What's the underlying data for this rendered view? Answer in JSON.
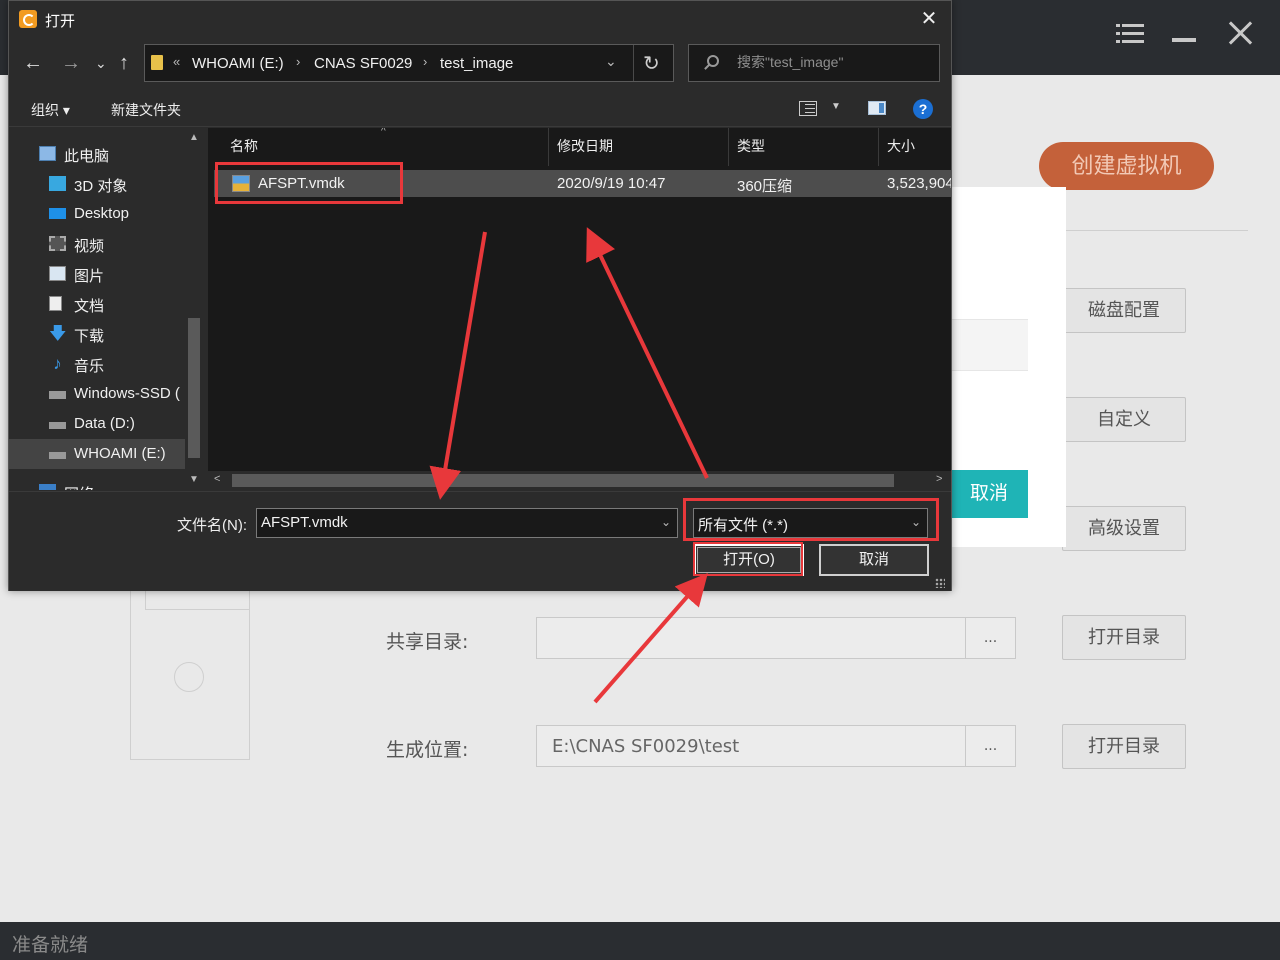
{
  "background_app": {
    "create_vm_label": "创建虚拟机",
    "side_buttons": [
      "磁盘配置",
      "自定义",
      "高级设置"
    ],
    "share_dir_label": "共享目录:",
    "share_dir_value": "",
    "output_label": "生成位置:",
    "output_value": "E:\\CNAS SF0029\\test",
    "browse_label": "...",
    "open_dir_label": "打开目录",
    "status_text": "准备就绪"
  },
  "underlying_dialog": {
    "cancel_label": "取消"
  },
  "dialog": {
    "title": "打开",
    "close_glyph": "✕",
    "nav": {
      "back": "←",
      "forward": "→",
      "recent": "⌄",
      "up": "↑"
    },
    "address": {
      "overflow": "«",
      "crumbs": [
        "WHOAMI (E:)",
        "CNAS SF0029",
        "test_image"
      ]
    },
    "search_placeholder": "搜索\"test_image\"",
    "toolbar": {
      "organize": "组织 ▾",
      "new_folder": "新建文件夹",
      "help": "?"
    },
    "nav_items": [
      {
        "label": "此电脑",
        "icon": "computer-icon"
      },
      {
        "label": "3D 对象",
        "icon": "cube-icon"
      },
      {
        "label": "Desktop",
        "icon": "desktop-icon"
      },
      {
        "label": "视频",
        "icon": "video-icon"
      },
      {
        "label": "图片",
        "icon": "picture-icon"
      },
      {
        "label": "文档",
        "icon": "document-icon"
      },
      {
        "label": "下载",
        "icon": "download-icon"
      },
      {
        "label": "音乐",
        "icon": "music-icon"
      },
      {
        "label": "Windows-SSD (",
        "icon": "drive-icon"
      },
      {
        "label": "Data (D:)",
        "icon": "drive-icon"
      },
      {
        "label": "WHOAMI (E:)",
        "icon": "drive-icon"
      },
      {
        "label": "网络",
        "icon": "network-icon"
      }
    ],
    "columns": [
      "名称",
      "修改日期",
      "类型",
      "大小"
    ],
    "files": [
      {
        "name": "AFSPT.vmdk",
        "modified": "2020/9/19 10:47",
        "type": "360压缩",
        "size": "3,523,904"
      }
    ],
    "filename_label": "文件名(N):",
    "filename_value": "AFSPT.vmdk",
    "filter_value": "所有文件 (*.*)",
    "open_button": "打开(O)",
    "cancel_button": "取消"
  },
  "colors": {
    "highlight_red": "#e8383b",
    "accent_orange": "#c4613a",
    "teal": "#1fb4b6",
    "help_blue": "#1b6fd3"
  }
}
